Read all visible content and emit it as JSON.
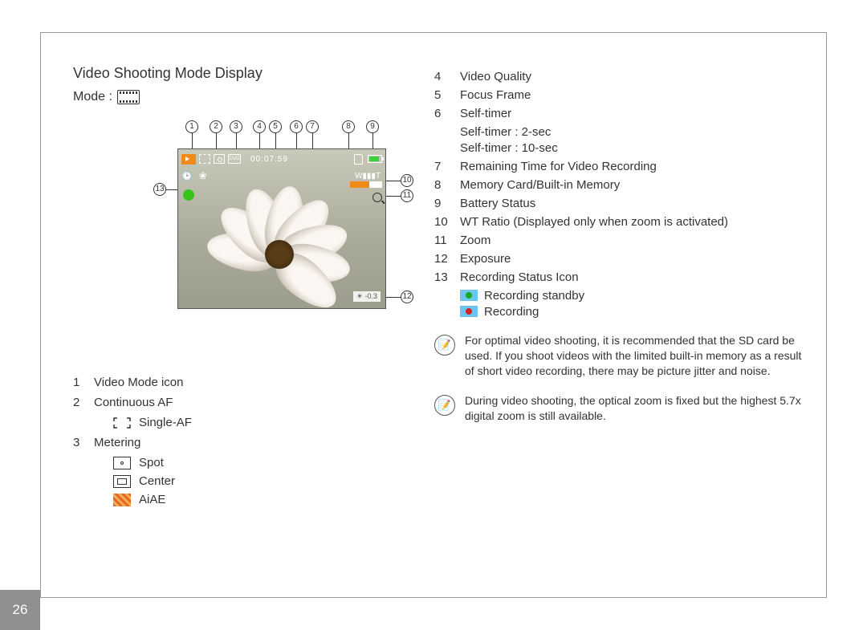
{
  "page_number": "26",
  "title": "Video Shooting Mode Display",
  "mode_label": "Mode :",
  "screen": {
    "time": "00:07:59",
    "exposure": "-0.3",
    "zoom_char": "⚲"
  },
  "callouts": [
    "1",
    "2",
    "3",
    "4",
    "5",
    "6",
    "7",
    "8",
    "9",
    "10",
    "11",
    "12",
    "13"
  ],
  "left": {
    "item1": {
      "n": "1",
      "label": "Video Mode icon"
    },
    "item2": {
      "n": "2",
      "label": "Continuous AF"
    },
    "item2_sub": {
      "label": "Single-AF"
    },
    "item3": {
      "n": "3",
      "label": "Metering"
    },
    "item3_subs": {
      "spot": "Spot",
      "center": "Center",
      "aiae": "AiAE"
    }
  },
  "right": {
    "items": [
      {
        "n": "4",
        "label": "Video Quality"
      },
      {
        "n": "5",
        "label": "Focus Frame"
      },
      {
        "n": "6",
        "label": "Self-timer"
      }
    ],
    "self_subs": [
      "Self-timer : 2-sec",
      "Self-timer : 10-sec"
    ],
    "items2": [
      {
        "n": "7",
        "label": "Remaining Time for Video Recording"
      },
      {
        "n": "8",
        "label": "Memory Card/Built-in Memory"
      },
      {
        "n": "9",
        "label": "Battery Status"
      },
      {
        "n": "10",
        "label": "WT Ratio (Displayed only when zoom is activated)"
      },
      {
        "n": "11",
        "label": " Zoom"
      },
      {
        "n": "12",
        "label": "Exposure"
      },
      {
        "n": "13",
        "label": "Recording Status Icon"
      }
    ],
    "status": {
      "standby": "Recording standby",
      "recording": "Recording"
    },
    "note1": "For optimal video shooting, it is recommended that the SD card be used. If you shoot videos with the limited built-in memory as a result of short video recording, there may be picture jitter and noise.",
    "note2": "During video shooting, the optical zoom is fixed but the highest 5.7x digital zoom is still available."
  }
}
